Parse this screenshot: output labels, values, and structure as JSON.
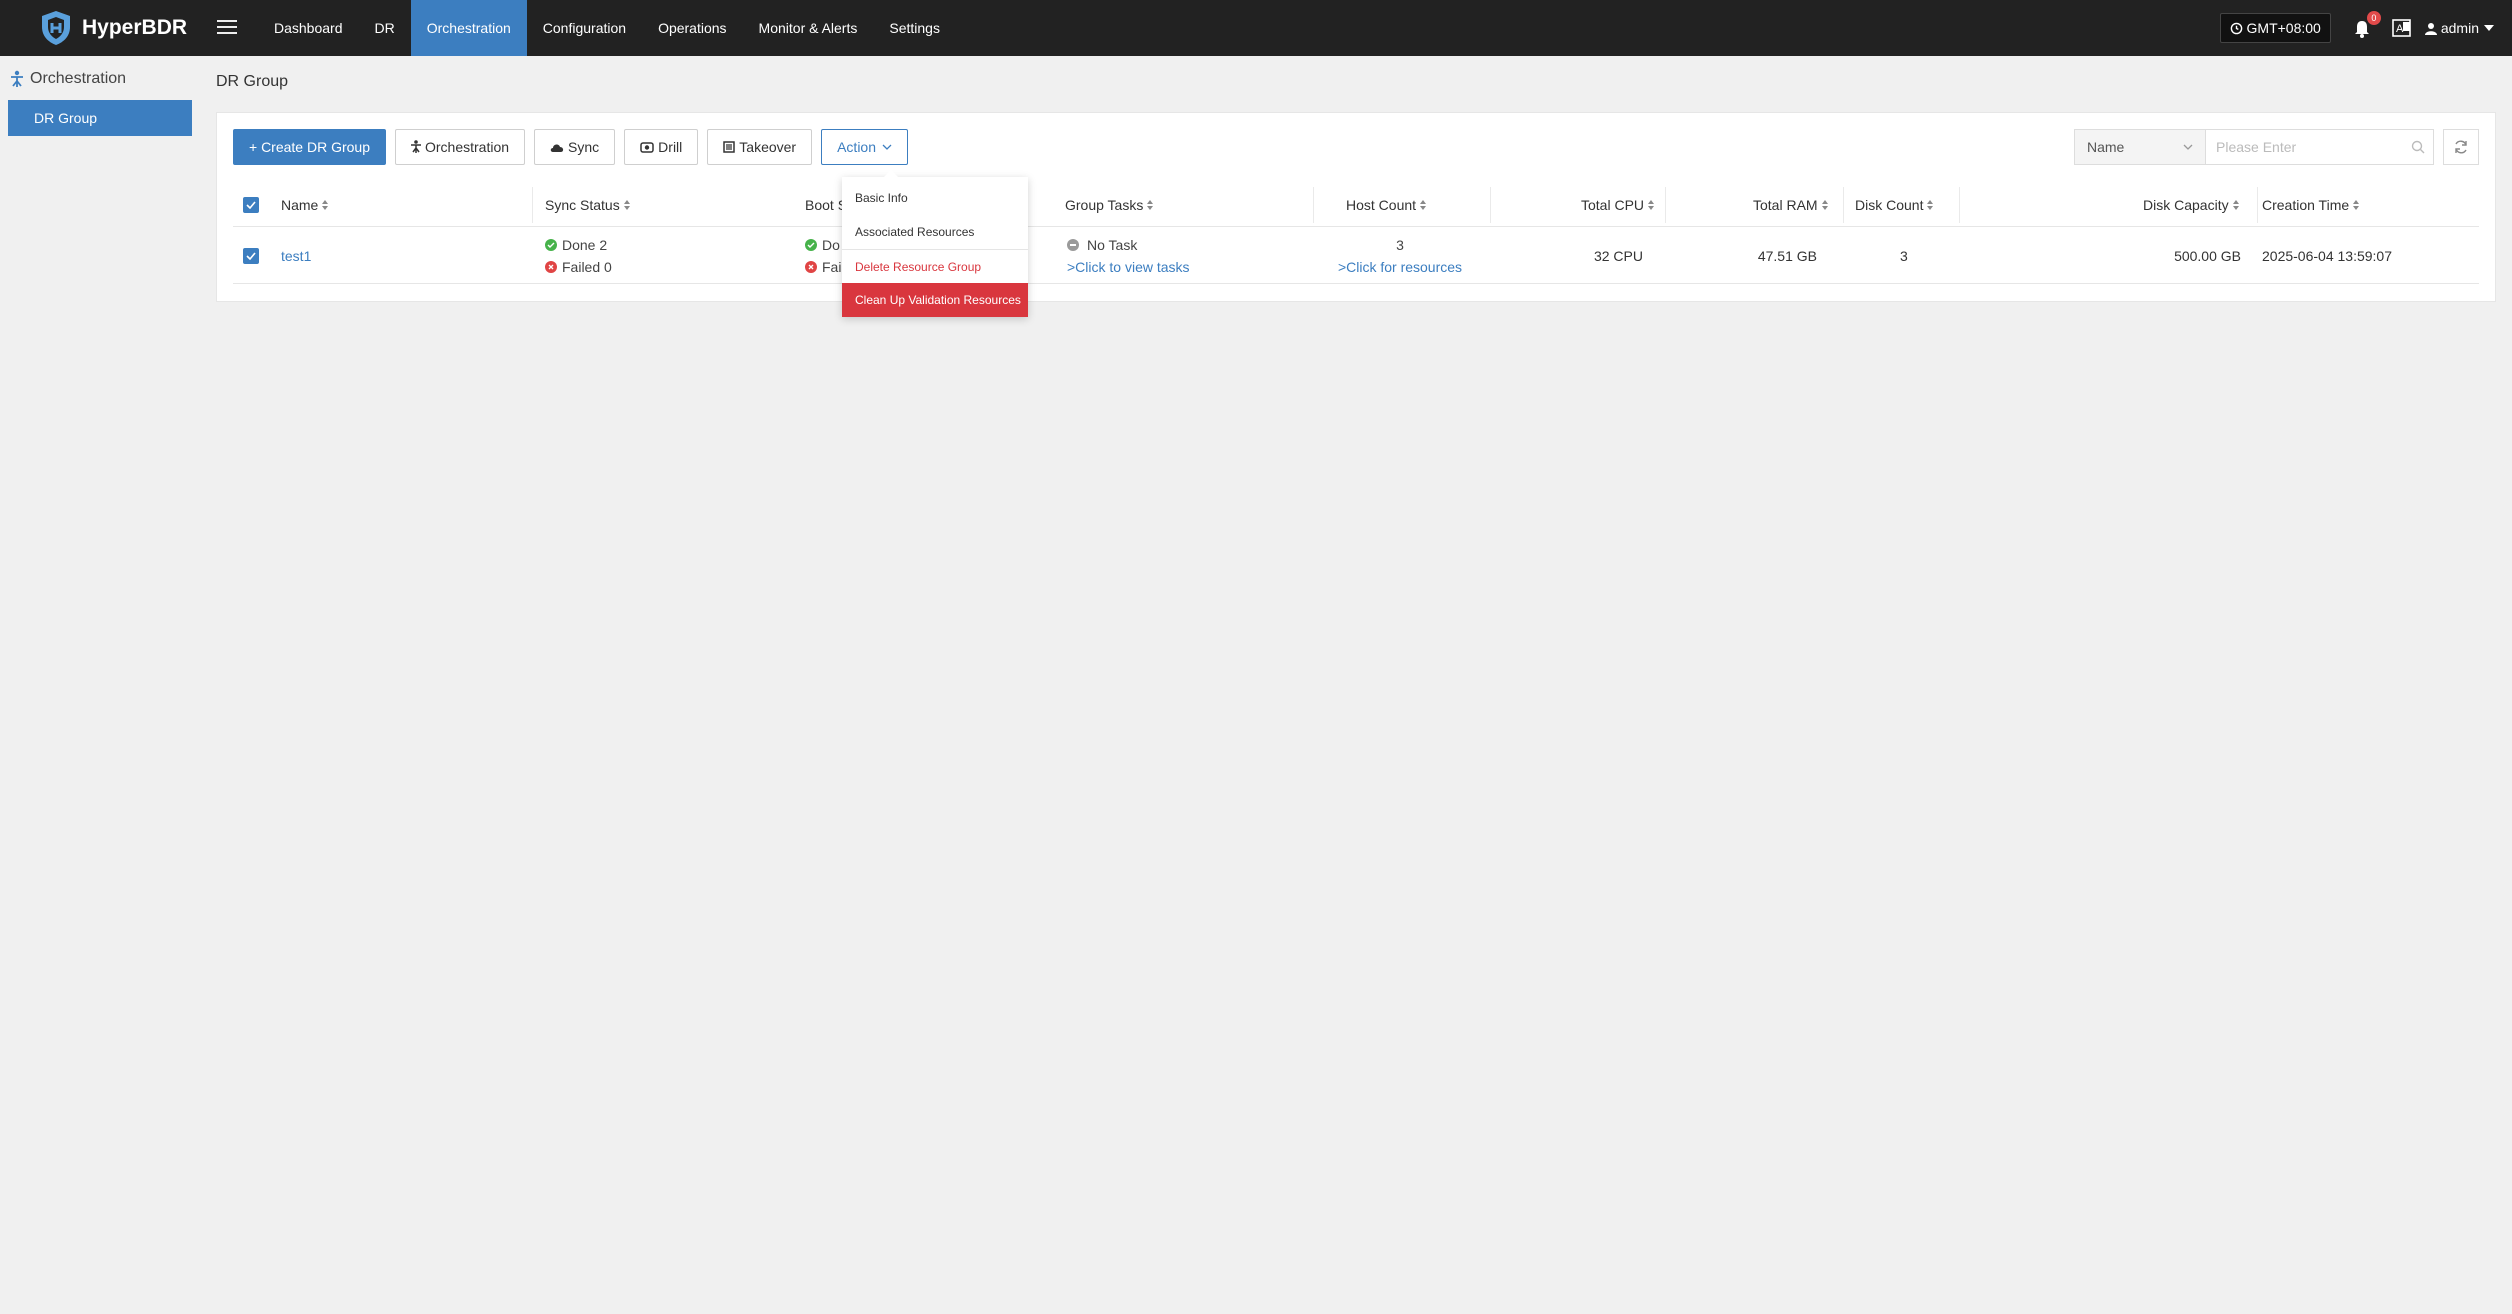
{
  "app": {
    "name": "HyperBDR"
  },
  "nav": {
    "items": [
      {
        "label": "Dashboard",
        "active": false
      },
      {
        "label": "DR",
        "active": false
      },
      {
        "label": "Orchestration",
        "active": true
      },
      {
        "label": "Configuration",
        "active": false
      },
      {
        "label": "Operations",
        "active": false
      },
      {
        "label": "Monitor & Alerts",
        "active": false
      },
      {
        "label": "Settings",
        "active": false
      }
    ],
    "timezone": "GMT+08:00",
    "notification_count": "0",
    "user": "admin"
  },
  "sidebar": {
    "title": "Orchestration",
    "items": [
      {
        "label": "DR Group",
        "active": true
      }
    ]
  },
  "page": {
    "title": "DR Group"
  },
  "toolbar": {
    "create": "+ Create DR Group",
    "orchestration": "Orchestration",
    "sync": "Sync",
    "drill": "Drill",
    "takeover": "Takeover",
    "action": "Action"
  },
  "search": {
    "field": "Name",
    "placeholder": "Please Enter"
  },
  "table": {
    "headers": {
      "name": "Name",
      "sync_status": "Sync Status",
      "boot_status": "Boot S",
      "group_tasks": "Group Tasks",
      "host_count": "Host Count",
      "total_cpu": "Total CPU",
      "total_ram": "Total RAM",
      "disk_count": "Disk Count",
      "disk_capacity": "Disk Capacity",
      "creation_time": "Creation Time"
    },
    "rows": [
      {
        "name": "test1",
        "sync_done": "Done 2",
        "sync_failed": "Failed 0",
        "boot_done": "Do",
        "boot_failed": "Faili",
        "task": "No Task",
        "task_link": ">Click to view tasks",
        "host_count": "3",
        "host_link": ">Click for resources",
        "total_cpu": "32 CPU",
        "total_ram": "47.51 GB",
        "disk_count": "3",
        "disk_capacity": "500.00 GB",
        "creation_time": "2025-06-04 13:59:07"
      }
    ]
  },
  "action_menu": {
    "basic_info": "Basic Info",
    "associated_resources": "Associated Resources",
    "delete_group": "Delete Resource Group",
    "clean_up": "Clean Up Validation Resources"
  },
  "colors": {
    "primary": "#3c7ec0",
    "navbar": "#222222",
    "danger": "#d9363e",
    "success": "#46b24a"
  }
}
